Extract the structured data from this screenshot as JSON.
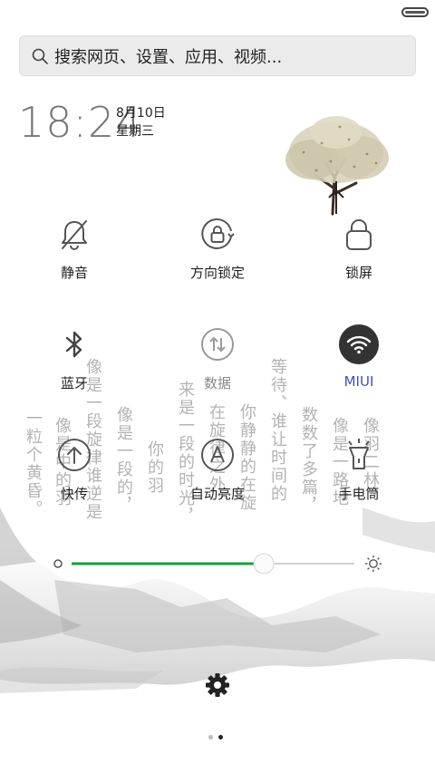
{
  "search": {
    "placeholder": "搜索网页、设置、应用、视频..."
  },
  "clock": {
    "time": "18:24",
    "date": "8月10日",
    "weekday": "星期三"
  },
  "toggles": [
    {
      "label": "静音",
      "icon": "bell-off-icon",
      "active": false
    },
    {
      "label": "方向锁定",
      "icon": "rotation-lock-icon",
      "active": false
    },
    {
      "label": "锁屏",
      "icon": "lock-icon",
      "active": false
    },
    {
      "label": "蓝牙",
      "icon": "bluetooth-icon",
      "active": false
    },
    {
      "label": "数据",
      "icon": "data-arrows-icon",
      "active": false,
      "disabled": true
    },
    {
      "label": "MIUI",
      "icon": "wifi-icon",
      "active": true
    },
    {
      "label": "快传",
      "icon": "upload-icon",
      "active": false
    },
    {
      "label": "自动亮度",
      "icon": "auto-brightness-icon",
      "active": false
    },
    {
      "label": "手电筒",
      "icon": "flashlight-icon",
      "active": false
    }
  ],
  "brightness": {
    "level": 0.68
  },
  "pager": {
    "current": 2,
    "total": 2
  },
  "colors": {
    "accent_blue": "#3d4fc7",
    "slider_green": "#1a9e3b",
    "wifi_bg": "#333333"
  }
}
